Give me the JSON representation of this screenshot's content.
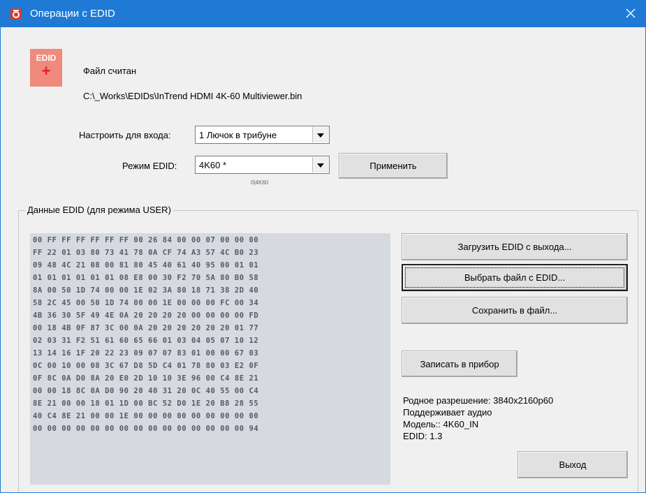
{
  "window": {
    "title": "Операции с EDID"
  },
  "logo": {
    "text": "EDID",
    "plus": "+"
  },
  "status": "Файл считан",
  "file_path": "C:\\_Works\\EDIDs\\InTrend HDMI 4K-60 Multiviewer.bin",
  "input_select": {
    "label": "Настроить для входа:",
    "value": "1  Лючок в трибуне"
  },
  "mode_select": {
    "label": "Режим EDID:",
    "value": "4K60  *",
    "hint": "0|4K60"
  },
  "buttons": {
    "apply": "Применить",
    "load_from_output": "Загрузить EDID с выхода...",
    "choose_file": "Выбрать файл с EDID...",
    "save_file": "Сохранить в файл...",
    "write_device": "Записать в прибор",
    "exit": "Выход"
  },
  "group": {
    "title": "Данные EDID (для режима USER)"
  },
  "hex_rows": [
    "00 FF FF FF FF FF FF 00 26 84 00 00 07 00 00 00",
    "FF 22 01 03 80 73 41 78 0A CF 74 A3 57 4C B0 23",
    "09 48 4C 21 08 00 81 80 45 40 61 40 95 00 01 01",
    "01 01 01 01 01 01 08 E8 00 30 F2 70 5A 80 B0 58",
    "8A 00 50 1D 74 00 00 1E 02 3A 80 18 71 38 2D 40",
    "58 2C 45 00 50 1D 74 00 00 1E 00 00 00 FC 00 34",
    "4B 36 30 5F 49 4E 0A 20 20 20 20 00 00 00 00 FD",
    "00 18 4B 0F 87 3C 00 0A 20 20 20 20 20 20 01 77",
    "02 03 31 F2 51 61 60 65 66 01 03 04 05 07 10 12",
    "13 14 16 1F 20 22 23 09 07 07 83 01 00 00 67 03",
    "0C 00 10 00 08 3C 67 D8 5D C4 01 78 80 03 E2 0F",
    "0F 8C 0A D0 8A 20 E0 2D 10 10 3E 96 00 C4 8E 21",
    "00 00 18 8C 0A D0 90 20 40 31 20 0C 40 55 00 C4",
    "8E 21 00 00 18 01 1D 00 BC 52 D0 1E 20 B8 28 55",
    "40 C4 8E 21 00 00 1E 00 00 00 00 00 00 00 00 00",
    "00 00 00 00 00 00 00 00 00 00 00 00 00 00 00 94"
  ],
  "info": {
    "native_resolution": "Родное разрешение: 3840x2160p60",
    "audio": "Поддерживает аудио",
    "model": "Модель:: 4K60_IN",
    "edid_version": "EDID: 1.3"
  },
  "colors": {
    "titlebar": "#1f7ad6",
    "logo_bg": "#ef8a7d",
    "hex_bg": "#d6d9e0"
  }
}
